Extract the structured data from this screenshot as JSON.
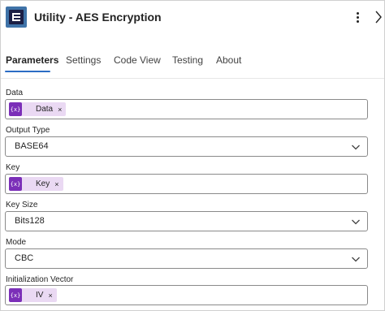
{
  "header": {
    "title": "Utility - AES Encryption",
    "icons": {
      "app": "app-logo-icon",
      "more": "more-options-icon",
      "collapse": "collapse-panel-icon"
    }
  },
  "tabs": [
    {
      "label": "Parameters",
      "active": true
    },
    {
      "label": "Settings",
      "active": false
    },
    {
      "label": "Code View",
      "active": false
    },
    {
      "label": "Testing",
      "active": false
    },
    {
      "label": "About",
      "active": false
    }
  ],
  "fields": {
    "data": {
      "label": "Data",
      "token_symbol": "{x}",
      "token_label": "Data",
      "remove": "×"
    },
    "output_type": {
      "label": "Output Type",
      "value": "BASE64"
    },
    "key": {
      "label": "Key",
      "token_symbol": "{x}",
      "token_label": "Key",
      "remove": "×"
    },
    "key_size": {
      "label": "Key Size",
      "value": "Bits128"
    },
    "mode": {
      "label": "Mode",
      "value": "CBC"
    },
    "iv": {
      "label": "Initialization Vector",
      "token_symbol": "{x}",
      "token_label": "IV",
      "remove": "×"
    }
  },
  "colors": {
    "accent": "#2b6cc4",
    "token_bg": "#ead9f3",
    "token_badge": "#7b2fb8",
    "app_icon": "#3f73a8"
  }
}
